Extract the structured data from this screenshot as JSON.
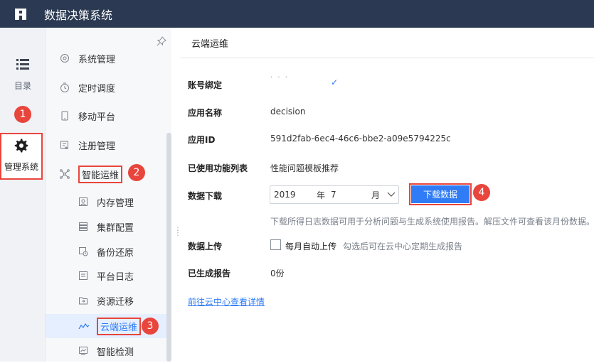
{
  "app": {
    "title": "数据决策系统"
  },
  "rail": {
    "catalog_label": "目录",
    "admin_label": "管理系统"
  },
  "sidebar": {
    "items": [
      {
        "label": "系统管理",
        "icon": "gear-outline-icon"
      },
      {
        "label": "定时调度",
        "icon": "timer-icon"
      },
      {
        "label": "移动平台",
        "icon": "mobile-icon"
      },
      {
        "label": "注册管理",
        "icon": "register-icon"
      },
      {
        "label": "智能运维",
        "icon": "network-icon"
      }
    ],
    "sub_items": [
      {
        "label": "内存管理",
        "icon": "memory-icon"
      },
      {
        "label": "集群配置",
        "icon": "cluster-icon"
      },
      {
        "label": "备份还原",
        "icon": "backup-icon"
      },
      {
        "label": "平台日志",
        "icon": "log-icon"
      },
      {
        "label": "资源迁移",
        "icon": "migrate-icon"
      },
      {
        "label": "云端运维",
        "icon": "cloud-icon",
        "active": true
      },
      {
        "label": "智能检测",
        "icon": "detect-icon"
      }
    ]
  },
  "main": {
    "header": "云端运维",
    "account_label": "账号绑定",
    "account_value": "· · ·",
    "app_name_label": "应用名称",
    "app_name_value": "decision",
    "app_id_label": "应用ID",
    "app_id_value": "591d2fab-6ec4-46c6-bbe2-a09e5794225c",
    "features_label": "已使用功能列表",
    "features_value": "性能问题模板推荐",
    "download_label": "数据下载",
    "date": {
      "year": "2019",
      "year_unit": "年",
      "month": "7",
      "month_unit": "月"
    },
    "download_button": "下载数据",
    "download_hint": "下载所得日志数据可用于分析问题与生成系统使用报告。解压文件可查看该月份数据。",
    "upload_label": "数据上传",
    "upload_checkbox": "每月自动上传",
    "upload_hint": "勾选后可在云中心定期生成报告",
    "reports_label": "已生成报告",
    "reports_value": "0份",
    "cloud_link": "前往云中心查看详情"
  },
  "callouts": [
    "1",
    "2",
    "3",
    "4"
  ],
  "colors": {
    "topbar": "#2b3a52",
    "accent": "#2f7cf6",
    "callout": "#e8453c"
  }
}
